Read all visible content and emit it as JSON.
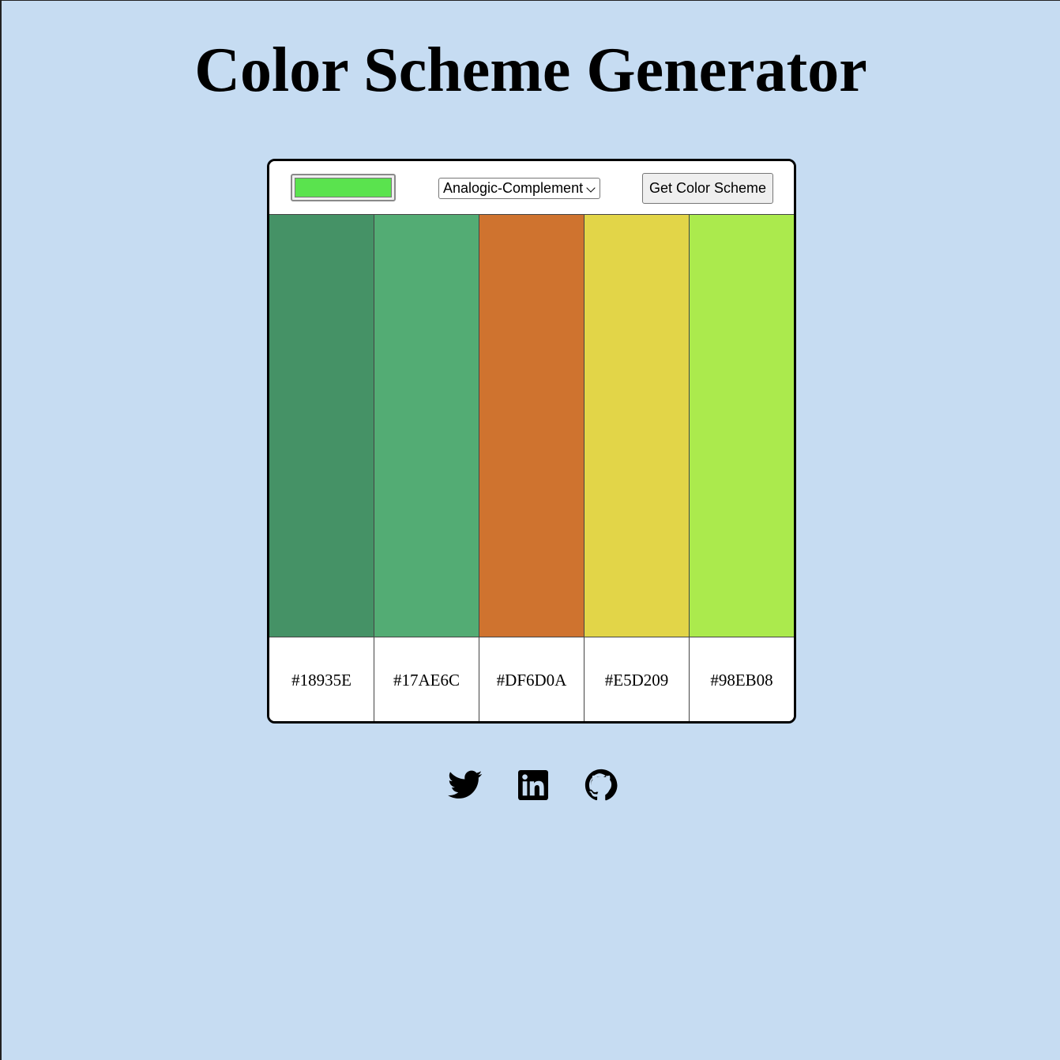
{
  "page": {
    "title": "Color Scheme Generator",
    "background_color": "#c6dcf2"
  },
  "controls": {
    "seed_color": "#5ae34e",
    "mode_selected": "Analogic-Complement",
    "button_label": "Get Color Scheme"
  },
  "scheme": {
    "swatches": [
      {
        "hex": "#18935E",
        "display_color": "#459266"
      },
      {
        "hex": "#17AE6C",
        "display_color": "#53ac74"
      },
      {
        "hex": "#DF6D0A",
        "display_color": "#cf732f"
      },
      {
        "hex": "#E5D209",
        "display_color": "#e2d548"
      },
      {
        "hex": "#98EB08",
        "display_color": "#abea4d"
      }
    ]
  },
  "socials": [
    {
      "name": "Twitter",
      "icon": "twitter-icon"
    },
    {
      "name": "LinkedIn",
      "icon": "linkedin-icon"
    },
    {
      "name": "GitHub",
      "icon": "github-icon"
    }
  ]
}
